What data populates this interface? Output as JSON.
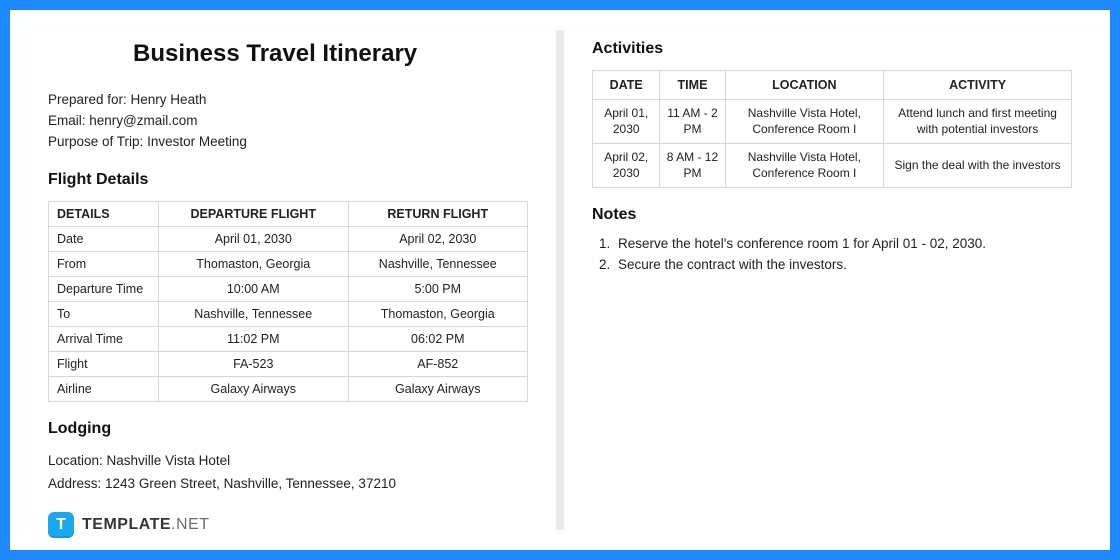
{
  "title": "Business Travel Itinerary",
  "meta": {
    "prepared_for_label": "Prepared for: ",
    "prepared_for": "Henry Heath",
    "email_label": "Email: ",
    "email": "henry@zmail.com",
    "purpose_label": "Purpose of Trip: ",
    "purpose": "Investor Meeting"
  },
  "flight": {
    "heading": "Flight Details",
    "headers": [
      "DETAILS",
      "DEPARTURE FLIGHT",
      "RETURN FLIGHT"
    ],
    "rows": [
      {
        "label": "Date",
        "dep": "April 01, 2030",
        "ret": "April 02, 2030"
      },
      {
        "label": "From",
        "dep": "Thomaston, Georgia",
        "ret": "Nashville, Tennessee"
      },
      {
        "label": "Departure Time",
        "dep": "10:00 AM",
        "ret": "5:00 PM"
      },
      {
        "label": "To",
        "dep": "Nashville, Tennessee",
        "ret": "Thomaston, Georgia"
      },
      {
        "label": "Arrival Time",
        "dep": "11:02 PM",
        "ret": "06:02 PM"
      },
      {
        "label": "Flight",
        "dep": "FA-523",
        "ret": "AF-852"
      },
      {
        "label": "Airline",
        "dep": "Galaxy Airways",
        "ret": "Galaxy Airways"
      }
    ]
  },
  "lodging": {
    "heading": "Lodging",
    "location_label": "Location: ",
    "location": "Nashville Vista Hotel",
    "address_label": "Address: ",
    "address": "1243 Green Street, Nashville, Tennessee, 37210"
  },
  "activities": {
    "heading": "Activities",
    "headers": [
      "DATE",
      "TIME",
      "LOCATION",
      "ACTIVITY"
    ],
    "rows": [
      {
        "date": "April 01, 2030",
        "time": "11 AM - 2 PM",
        "loc": "Nashville Vista Hotel, Conference Room I",
        "act": "Attend lunch and first meeting with potential investors"
      },
      {
        "date": "April 02, 2030",
        "time": "8 AM - 12 PM",
        "loc": "Nashville Vista Hotel, Conference Room I",
        "act": "Sign the deal with the investors"
      }
    ]
  },
  "notes": {
    "heading": "Notes",
    "items": [
      "Reserve the hotel's conference room 1 for April 01 - 02, 2030.",
      "Secure the contract with the investors."
    ]
  },
  "watermark": {
    "badge": "T",
    "text_bold": "TEMPLATE",
    "text_light": ".NET"
  }
}
